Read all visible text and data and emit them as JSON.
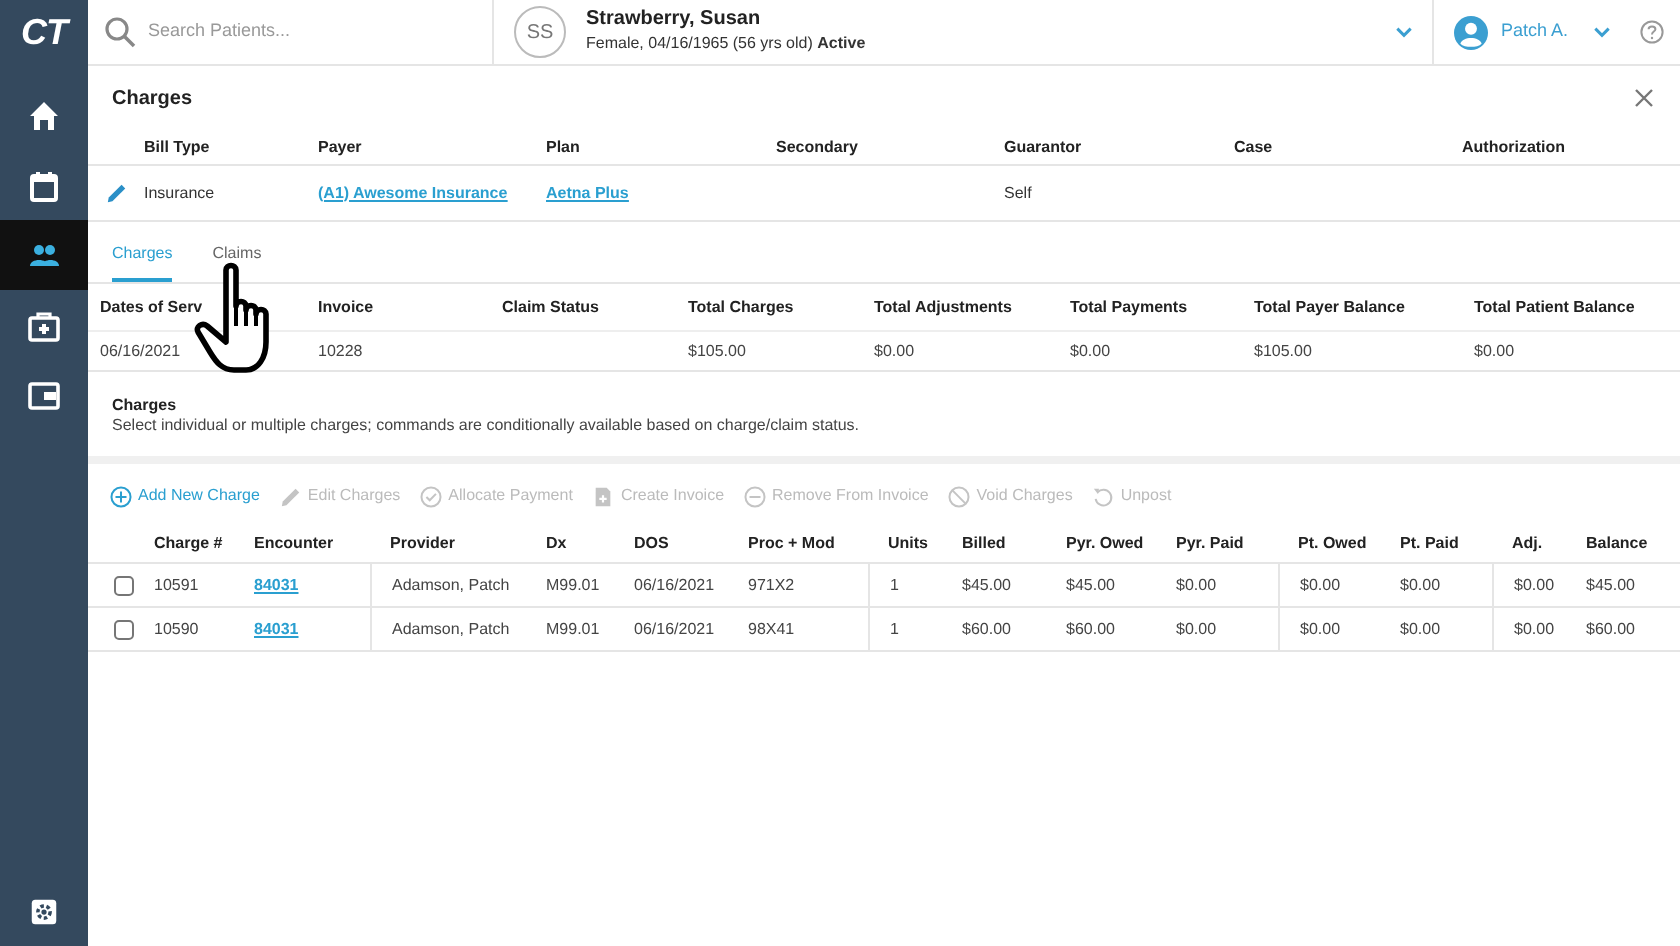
{
  "sidebar": {
    "logo": "CT",
    "items": [
      {
        "kind": "home",
        "selected": false
      },
      {
        "kind": "calendar",
        "selected": false
      },
      {
        "kind": "people",
        "selected": true
      },
      {
        "kind": "medkit",
        "selected": false
      },
      {
        "kind": "wallet",
        "selected": false
      }
    ],
    "bottom": {
      "kind": "settings"
    }
  },
  "header": {
    "search": {
      "placeholder": "Search Patients..."
    },
    "patient": {
      "initials": "SS",
      "name": "Strawberry, Susan",
      "details": "Female, 04/16/1965 (56 yrs old)",
      "status": "Active"
    },
    "user": "Patch A."
  },
  "panel": {
    "title": "Charges",
    "bill": {
      "columns": [
        "Bill Type",
        "Payer",
        "Plan",
        "Secondary",
        "Guarantor",
        "Case",
        "Authorization"
      ],
      "row": [
        {
          "text": "Insurance",
          "kind": "text"
        },
        {
          "text": "(A1) Awesome Insurance",
          "kind": "link"
        },
        {
          "text": "Aetna Plus",
          "kind": "link"
        },
        {
          "kind": "empty"
        },
        {
          "text": "Self",
          "kind": "text"
        },
        {
          "kind": "empty"
        },
        {
          "kind": "empty"
        }
      ]
    },
    "tabs": [
      {
        "label": "Charges",
        "selected": true
      },
      {
        "label": "Claims",
        "selected": false
      }
    ],
    "summary": {
      "columns": [
        "Dates of Serv",
        "Invoice",
        "Claim Status",
        "Total Charges",
        "Total Adjustments",
        "Total Payments",
        "Total Payer Balance",
        "Total Patient Balance"
      ],
      "row": [
        {
          "kind": "text",
          "text": "06/16/2021"
        },
        {
          "kind": "text",
          "text": "10228"
        },
        {
          "kind": "empty"
        },
        {
          "kind": "text",
          "text": "$105.00"
        },
        {
          "kind": "text",
          "text": "$0.00"
        },
        {
          "kind": "text",
          "text": "$0.00"
        },
        {
          "kind": "text",
          "text": "$105.00"
        },
        {
          "kind": "text",
          "text": "$0.00"
        }
      ]
    },
    "section": {
      "title": "Charges",
      "description": "Select individual or multiple charges; commands are conditionally available based on charge/claim status."
    },
    "actions": [
      {
        "kind": "add",
        "label": "Add New Charge",
        "disabled": false
      },
      {
        "kind": "edit",
        "label": "Edit Charges",
        "disabled": true
      },
      {
        "kind": "allocate",
        "label": "Allocate Payment",
        "disabled": true
      },
      {
        "kind": "invoice",
        "label": "Create Invoice",
        "disabled": true
      },
      {
        "kind": "remove",
        "label": "Remove From Invoice",
        "disabled": true
      },
      {
        "kind": "void",
        "label": "Void Charges",
        "disabled": true
      },
      {
        "kind": "unpost",
        "label": "Unpost",
        "disabled": true
      }
    ],
    "charges": {
      "columns": [
        {
          "label": "Charge #",
          "kind": "text"
        },
        {
          "label": "Encounter",
          "kind": "link"
        },
        {
          "label": "Provider",
          "kind": "text"
        },
        {
          "label": "Dx",
          "kind": "text"
        },
        {
          "label": "DOS",
          "kind": "text"
        },
        {
          "label": "Proc + Mod",
          "kind": "text"
        },
        {
          "label": "Units",
          "kind": "text"
        },
        {
          "label": "Billed",
          "kind": "text"
        },
        {
          "label": "Pyr. Owed",
          "kind": "text"
        },
        {
          "label": "Pyr. Paid",
          "kind": "text"
        },
        {
          "label": "Pt. Owed",
          "kind": "text"
        },
        {
          "label": "Pt. Paid",
          "kind": "text"
        },
        {
          "label": "Adj.",
          "kind": "text"
        },
        {
          "label": "Balance",
          "kind": "text"
        }
      ],
      "rows": [
        {
          "checked": false,
          "cells": [
            "10591",
            "84031",
            "Adamson, Patch",
            "M99.01",
            "06/16/2021",
            "971X2",
            "1",
            "$45.00",
            "$45.00",
            "$0.00",
            "$0.00",
            "$0.00",
            "$0.00",
            "$45.00"
          ]
        },
        {
          "checked": false,
          "cells": [
            "10590",
            "84031",
            "Adamson, Patch",
            "M99.01",
            "06/16/2021",
            "98X41",
            "1",
            "$60.00",
            "$60.00",
            "$0.00",
            "$0.00",
            "$0.00",
            "$0.00",
            "$60.00"
          ]
        }
      ]
    }
  }
}
